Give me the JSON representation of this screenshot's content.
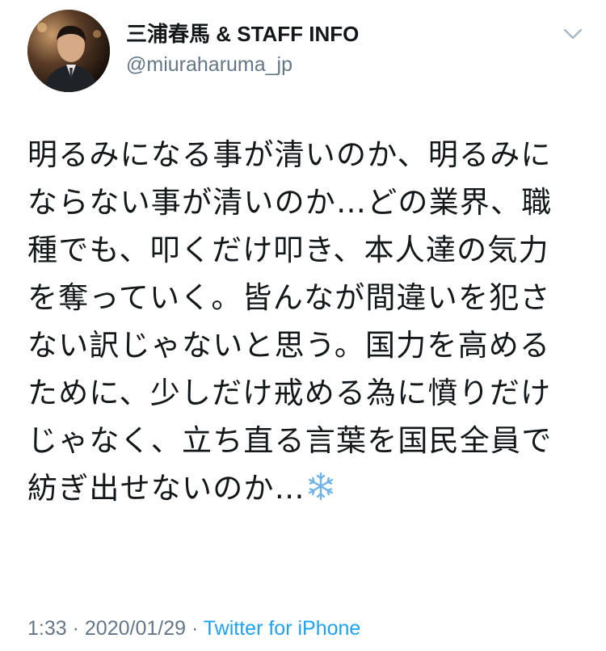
{
  "author": {
    "display_name": "三浦春馬 & STAFF INFO",
    "handle": "@miuraharuma_jp",
    "avatar_icon": "profile-photo"
  },
  "tweet": {
    "text": "明るみになる事が清いのか、明るみにならない事が清いのか…どの業界、職種でも、叩くだけ叩き、本人達の気力を奪っていく。皆んなが間違いを犯さない訳じゃないと思う。国力を高めるために、少しだけ戒める為に憤りだけじゃなく、立ち直る言葉を国民全員で紡ぎ出せないのか…",
    "emoji_icon": "snowflake-icon"
  },
  "meta": {
    "time": "1:33",
    "separator1": " · ",
    "date": "2020/01/29",
    "separator2": " · ",
    "source": "Twitter for iPhone"
  },
  "colors": {
    "text": "#14171a",
    "secondary": "#657786",
    "link": "#1da1f2"
  }
}
